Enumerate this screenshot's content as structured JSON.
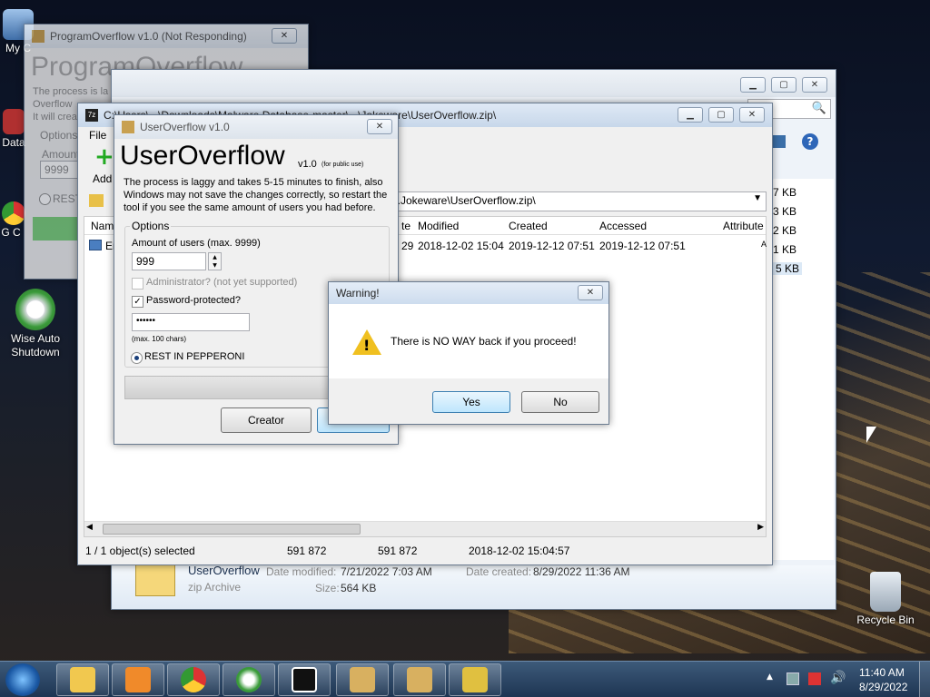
{
  "desktop": {
    "icons": [
      {
        "label": "My C"
      },
      {
        "label": "Data"
      },
      {
        "label": "G C"
      },
      {
        "label": "Wise Auto Shutdown"
      },
      {
        "label": "Recycle Bin"
      }
    ]
  },
  "program_overflow": {
    "title": "ProgramOverflow v1.0 (Not Responding)",
    "heading": "ProgramOverflow",
    "desc_lines": [
      "The process is la",
      "Overflow",
      "It will crea"
    ],
    "options_label": "Options",
    "amount_label": "Amount",
    "amount_value": "9999",
    "rest_label": "REST"
  },
  "explorer": {
    "search_icon": "search-icon",
    "help_icon": "help-icon",
    "file_name": "UserOverflow",
    "file_type": "zip Archive",
    "date_modified_label": "Date modified:",
    "date_modified": "7/21/2022 7:03 AM",
    "date_created_label": "Date created:",
    "date_created": "8/29/2022 11:36 AM",
    "size_label": "Size:",
    "size": "564 KB",
    "sizes": [
      "7 KB",
      "3 KB",
      "2 KB",
      "1 KB",
      "5 KB"
    ]
  },
  "sevenzip": {
    "title": "C:\\Users\\...\\Downloads\\Malware Database-master\\...\\Jokeware\\UserOverflow.zip\\",
    "menu_file": "File",
    "toolbar_add": "Add",
    "address": "...Jokeware\\UserOverflow.zip\\",
    "columns": [
      "Name",
      "te",
      "Modified",
      "Created",
      "Accessed",
      "Attribute"
    ],
    "row": {
      "name": "Er",
      "te": "29",
      "modified": "2018-12-02 15:04",
      "created": "2019-12-12 07:51",
      "accessed": "2019-12-12 07:51",
      "attr": "A"
    },
    "status": {
      "selected": "1 / 1 object(s) selected",
      "size": "591 872",
      "packed": "591 872",
      "date": "2018-12-02 15:04:57"
    }
  },
  "useroverflow": {
    "title": "UserOverflow v1.0",
    "heading": "UserOverflow",
    "version": "v1.0",
    "version_note": "(for public use)",
    "description": "The process is laggy and takes 5-15 minutes to finish, also Windows may not save the changes correctly, so restart the tool if you see the same amount of users you had before.",
    "options_label": "Options",
    "amount_label": "Amount of users (max. 9999)",
    "amount_value": "999",
    "admin_label": "Administrator? (not yet supported)",
    "password_label": "Password-protected?",
    "password_value": "••••••",
    "max_chars": "(max. 100 chars)",
    "rest_label": "REST IN PEPPERONI",
    "creator_button": "Creator"
  },
  "warning": {
    "title": "Warning!",
    "message": "There is NO WAY back if you proceed!",
    "yes": "Yes",
    "no": "No"
  },
  "taskbar": {
    "time": "11:40 AM",
    "date": "8/29/2022",
    "apps": [
      "explorer",
      "media-player",
      "chrome",
      "wise-auto-shutdown",
      "7-zip",
      "programoverflow",
      "useroverflow",
      "keytool"
    ]
  }
}
